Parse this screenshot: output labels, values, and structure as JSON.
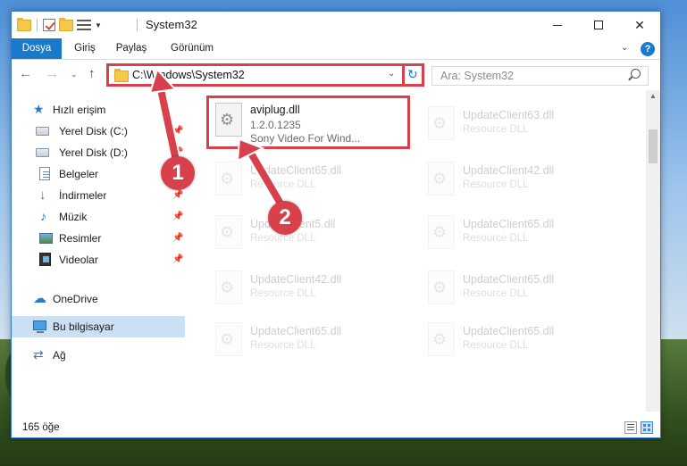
{
  "window": {
    "title": "System32"
  },
  "ribbon": {
    "tabs": [
      "Dosya",
      "Giriş",
      "Paylaş",
      "Görünüm"
    ]
  },
  "address": {
    "path": "C:\\Windows\\System32"
  },
  "search": {
    "placeholder": "Ara: System32"
  },
  "sidebar": {
    "items": [
      {
        "label": "Hızlı erişim",
        "icon": "star-icon",
        "pinned": false
      },
      {
        "label": "Yerel Disk (C:)",
        "icon": "drive-icon",
        "pinned": true
      },
      {
        "label": "Yerel Disk (D:)",
        "icon": "drive-icon",
        "pinned": true
      },
      {
        "label": "Belgeler",
        "icon": "document-icon",
        "pinned": true
      },
      {
        "label": "İndirmeler",
        "icon": "download-icon",
        "pinned": true
      },
      {
        "label": "Müzik",
        "icon": "music-icon",
        "pinned": true
      },
      {
        "label": "Resimler",
        "icon": "pictures-icon",
        "pinned": true
      },
      {
        "label": "Videolar",
        "icon": "video-icon",
        "pinned": true
      },
      {
        "label": "OneDrive",
        "icon": "cloud-icon",
        "pinned": false
      },
      {
        "label": "Bu bilgisayar",
        "icon": "computer-icon",
        "pinned": false,
        "selected": true
      },
      {
        "label": "Ağ",
        "icon": "network-icon",
        "pinned": false
      }
    ]
  },
  "files": {
    "highlighted": {
      "name": "aviplug.dll",
      "version": "1.2.0.1235",
      "company": "Sony Video For Wind..."
    },
    "faded": [
      {
        "name": "UpdateClient63.dll",
        "desc": "Resource DLL"
      },
      {
        "name": "UpdateClient65.dll",
        "desc": "Resource DLL"
      },
      {
        "name": "UpdateClient42.dll",
        "desc": "Resource DLL"
      },
      {
        "name": "UpdateClient5.dll",
        "desc": "Resource DLL"
      },
      {
        "name": "UpdateClient65.dll",
        "desc": "Resource DLL"
      },
      {
        "name": "UpdateClient42.dll",
        "desc": "Resource DLL"
      },
      {
        "name": "UpdateClient65.dll",
        "desc": "Resource DLL"
      },
      {
        "name": "UpdateClient65.dll",
        "desc": "Resource DLL"
      },
      {
        "name": "UpdateClient65.dll",
        "desc": "Resource DLL"
      }
    ]
  },
  "status": {
    "count": "165 öğe"
  },
  "annotations": {
    "step1": "1",
    "step2": "2",
    "color": "#d8404b"
  }
}
